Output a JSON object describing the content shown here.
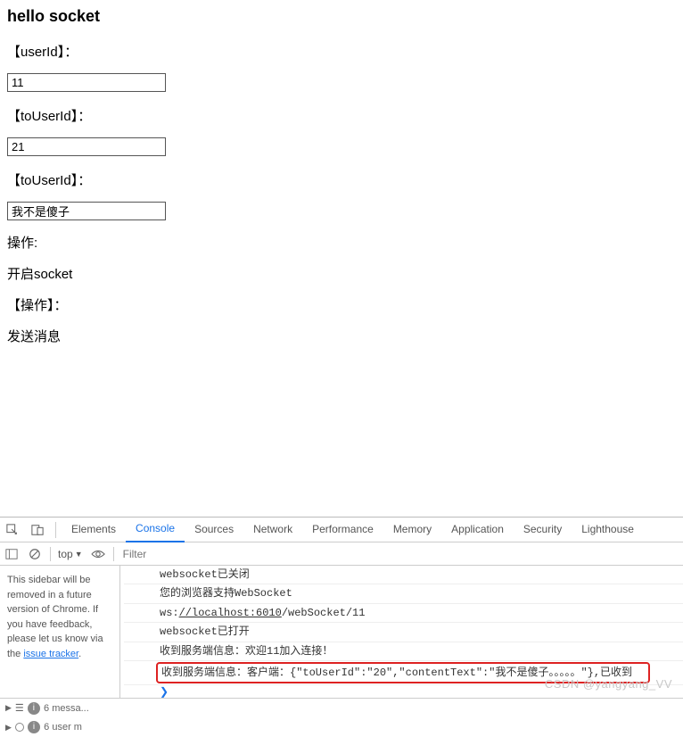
{
  "page": {
    "title": "hello socket",
    "fields": [
      {
        "label": "【userId】：",
        "value": "11"
      },
      {
        "label": "【toUserId】：",
        "value": "21"
      },
      {
        "label": "【toUserId】：",
        "value": "我不是傻子"
      }
    ],
    "ops_label": "操作:",
    "open_socket": "开启socket",
    "ops2_label": "【操作】：",
    "send_msg": "发送消息"
  },
  "devtools": {
    "tabs": [
      "Elements",
      "Console",
      "Sources",
      "Network",
      "Performance",
      "Memory",
      "Application",
      "Security",
      "Lighthouse"
    ],
    "active_tab": "Console",
    "context": "top",
    "filter_placeholder": "Filter",
    "sidebar_notice": "This sidebar will be removed in a future version of Chrome. If you have feedback, please let us know via the ",
    "sidebar_link": "issue tracker",
    "logs": [
      "websocket已关闭",
      "您的浏览器支持WebSocket",
      "ws://localhost:6010/webSocket/11",
      "websocket已打开",
      "收到服务端信息：欢迎11加入连接！",
      "收到服务端信息：客户端：{\"toUserId\":\"20\",\"contentText\":\"我不是傻子。。。。。\"},已收到"
    ],
    "footer": {
      "messages": "6 messa...",
      "users": "6 user m"
    }
  },
  "watermark": "CSDN @yangyang_VV"
}
